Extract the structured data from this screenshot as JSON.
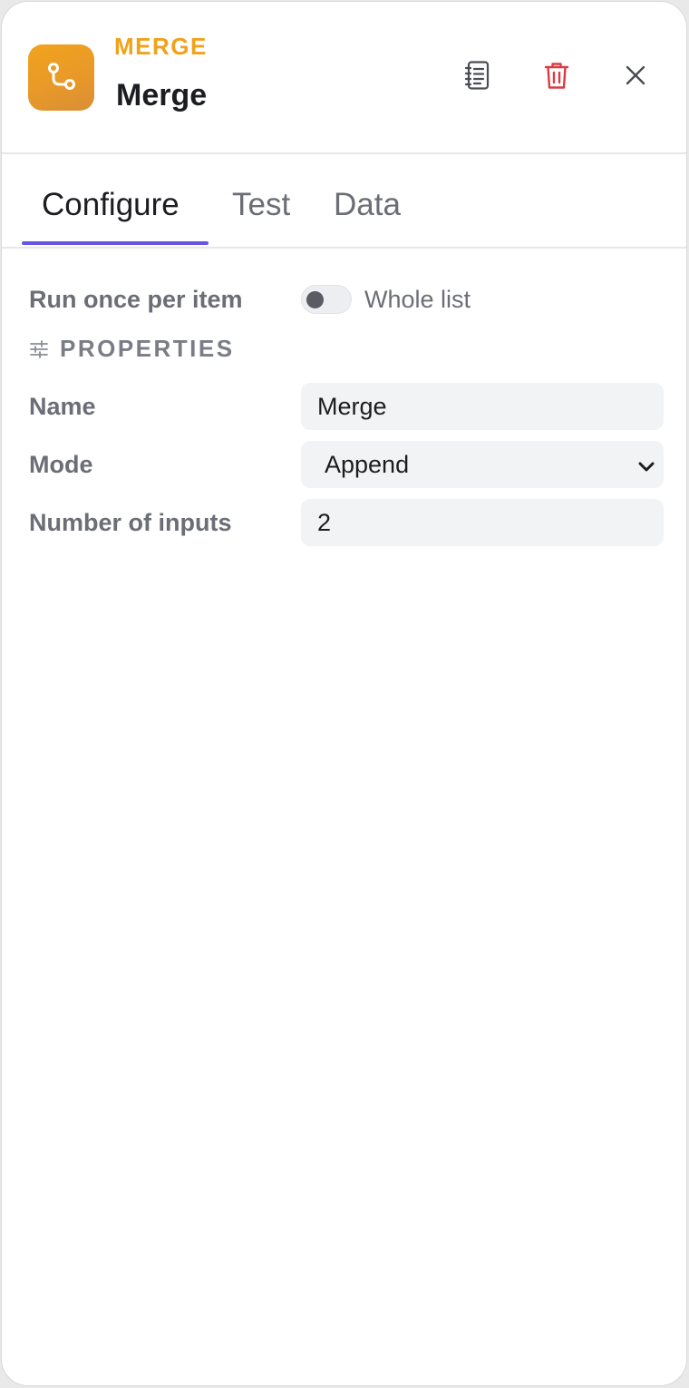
{
  "header": {
    "node_type": "MERGE",
    "node_title": "Merge",
    "icon": "merge-branch-icon",
    "icon_color": "#f0a21a",
    "actions": [
      {
        "icon": "docs-icon"
      },
      {
        "icon": "trash-icon",
        "color": "#dc3a44"
      },
      {
        "icon": "close-icon"
      }
    ]
  },
  "tabs": [
    {
      "label": "Configure",
      "active": true
    },
    {
      "label": "Test",
      "active": false
    },
    {
      "label": "Data",
      "active": false
    }
  ],
  "accent_color": "#6555e6",
  "run_mode": {
    "label": "Run once per item",
    "toggle_label": "Whole list",
    "toggle_on": false
  },
  "properties": {
    "title": "PROPERTIES",
    "icon": "sliders-icon",
    "fields": {
      "name": {
        "label": "Name",
        "value": "Merge"
      },
      "mode": {
        "label": "Mode",
        "value": "Append"
      },
      "inputs": {
        "label": "Number of inputs",
        "value": "2"
      }
    }
  }
}
